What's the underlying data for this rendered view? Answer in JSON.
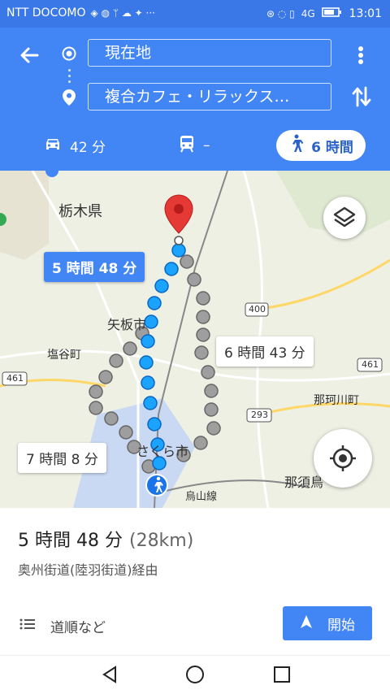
{
  "status_bar": {
    "carrier": "NTT DOCOMO",
    "time": "13:01",
    "network": "4G"
  },
  "header": {
    "origin": "現在地",
    "destination": "複合カフェ・リラックス…",
    "modes": [
      {
        "name": "car",
        "label": "42 分",
        "icon": "car-icon"
      },
      {
        "name": "transit",
        "label": "–",
        "icon": "train-icon"
      },
      {
        "name": "walk",
        "label": "6 時間",
        "icon": "walk-icon",
        "selected": true
      }
    ]
  },
  "map": {
    "labels": {
      "tochigi": "栃木県",
      "yaita": "矢板市",
      "shioya": "塩谷町",
      "nakagawa": "那珂川町",
      "sakura": "さくら市",
      "nasu": "那須鳥",
      "karasuyama": "烏山線",
      "r400": "400",
      "r461a": "461",
      "r461b": "461",
      "r293": "293"
    },
    "route_callouts": {
      "selected": "5 時間 48 分",
      "alt1": "6 時間 43 分",
      "alt2": "7 時間 8 分"
    },
    "colors": {
      "route_selected": "#1aa3ff",
      "route_alt": "#9e9e9e",
      "header": "#4285f4"
    }
  },
  "summary": {
    "time": "5 時間 48 分",
    "distance": "(28km)",
    "via": "奥州街道(陸羽街道)経由"
  },
  "actions": {
    "steps_label": "道順など",
    "start_label": "開始"
  }
}
